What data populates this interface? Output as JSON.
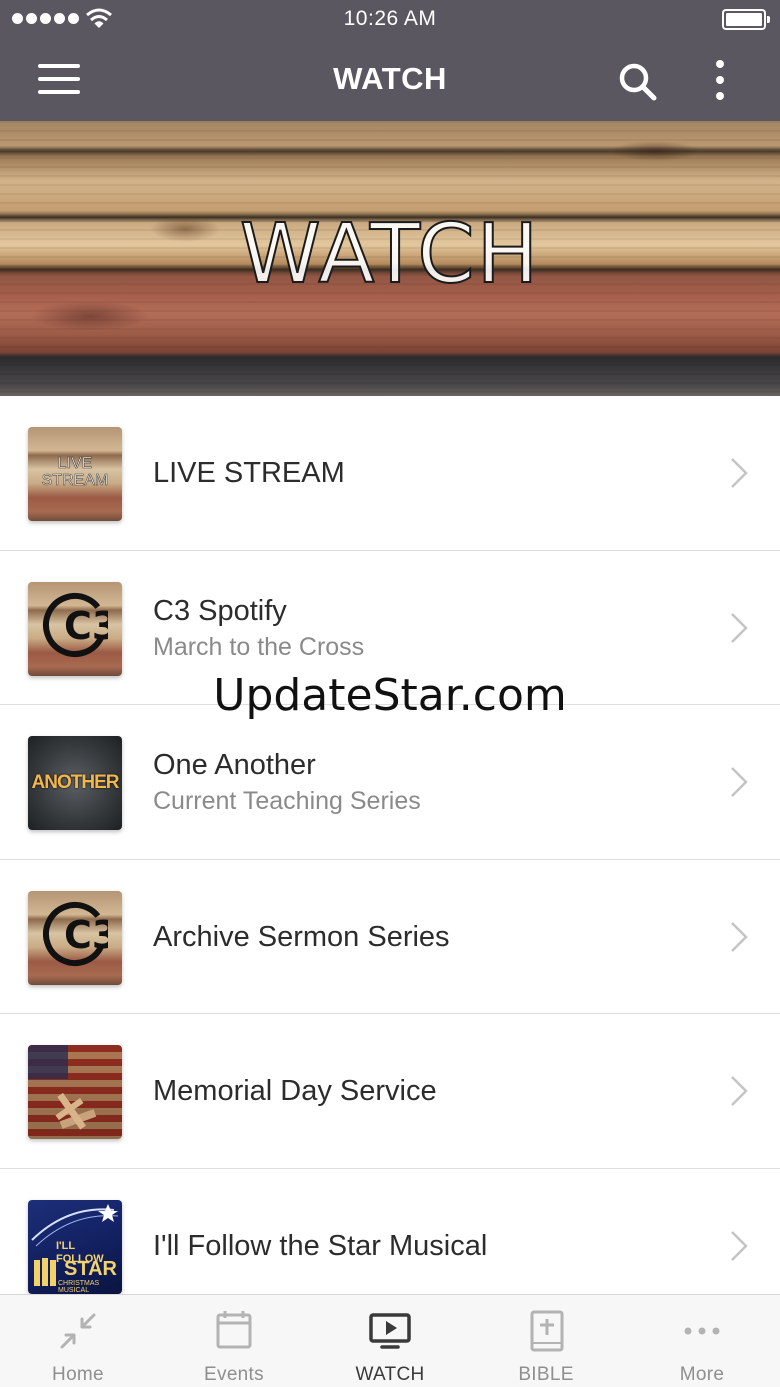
{
  "status_bar": {
    "time": "10:26 AM"
  },
  "nav": {
    "title": "WATCH"
  },
  "hero": {
    "title": "WATCH"
  },
  "list": {
    "items": [
      {
        "title": "LIVE STREAM",
        "subtitle": "",
        "thumb_text": "LIVE STREAM"
      },
      {
        "title": "C3 Spotify",
        "subtitle": "March to the Cross",
        "thumb_text": "C3"
      },
      {
        "title": "One Another",
        "subtitle": "Current Teaching Series",
        "thumb_text": "ANOTHER"
      },
      {
        "title": "Archive Sermon Series",
        "subtitle": "",
        "thumb_text": "C3"
      },
      {
        "title": "Memorial Day Service",
        "subtitle": "",
        "thumb_text": ""
      },
      {
        "title": "I'll Follow the Star Musical",
        "subtitle": "",
        "thumb_text": "I'LL FOLLOW",
        "thumb_text_2": "STAR",
        "thumb_text_3": "CHRISTMAS MUSICAL"
      }
    ]
  },
  "watermark": "UpdateStar.com",
  "tabs": [
    {
      "label": "Home",
      "icon": "compress-arrows-icon",
      "active": false
    },
    {
      "label": "Events",
      "icon": "calendar-icon",
      "active": false
    },
    {
      "label": "WATCH",
      "icon": "tv-play-icon",
      "active": true
    },
    {
      "label": "BIBLE",
      "icon": "bible-icon",
      "active": false
    },
    {
      "label": "More",
      "icon": "more-dots-icon",
      "active": false
    }
  ],
  "colors": {
    "nav_bar": "#5a5760",
    "active_tab": "#3a3a3a",
    "inactive_tab": "#8f8f8f"
  }
}
